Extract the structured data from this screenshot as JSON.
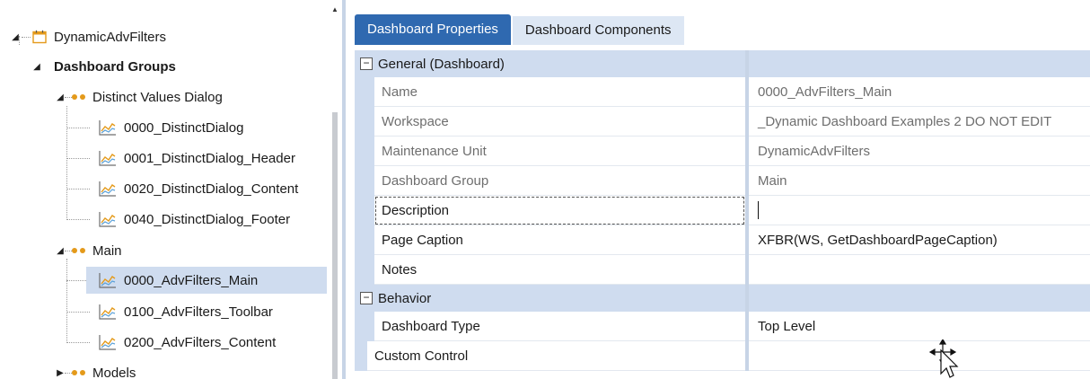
{
  "tree": {
    "root": "DynamicAdvFilters",
    "group_header": "Dashboard Groups",
    "groups": [
      {
        "label": "Distinct Values Dialog",
        "items": [
          "0000_DistinctDialog",
          "0001_DistinctDialog_Header",
          "0020_DistinctDialog_Content",
          "0040_DistinctDialog_Footer"
        ]
      },
      {
        "label": "Main",
        "items": [
          "0000_AdvFilters_Main",
          "0100_AdvFilters_Toolbar",
          "0200_AdvFilters_Content"
        ],
        "selected_item": "0000_AdvFilters_Main"
      },
      {
        "label": "Models",
        "items": []
      }
    ]
  },
  "tabs": [
    {
      "label": "Dashboard Properties",
      "active": true
    },
    {
      "label": "Dashboard Components",
      "active": false
    }
  ],
  "categories": {
    "general": "General (Dashboard)",
    "behavior": "Behavior"
  },
  "properties": {
    "name": {
      "label": "Name",
      "value": "0000_AdvFilters_Main"
    },
    "workspace": {
      "label": "Workspace",
      "value": "_Dynamic Dashboard Examples 2 DO NOT EDIT"
    },
    "maintenance_unit": {
      "label": "Maintenance Unit",
      "value": "DynamicAdvFilters"
    },
    "dashboard_group": {
      "label": "Dashboard Group",
      "value": "Main"
    },
    "description": {
      "label": "Description",
      "value": ""
    },
    "page_caption": {
      "label": "Page Caption",
      "value": "XFBR(WS, GetDashboardPageCaption)"
    },
    "notes": {
      "label": "Notes",
      "value": ""
    },
    "dashboard_type": {
      "label": "Dashboard Type",
      "value": "Top Level"
    },
    "custom_control": {
      "label": "Custom Control",
      "value": ""
    }
  },
  "colors": {
    "accent": "#2f69b0",
    "category_band": "#cfdcef",
    "selection": "#cfdcef",
    "group_dot": "#e49a1a"
  },
  "icons": [
    "calendar-icon",
    "group-dots-icon",
    "chart-icon",
    "collapse-icon",
    "move-cursor-icon"
  ]
}
